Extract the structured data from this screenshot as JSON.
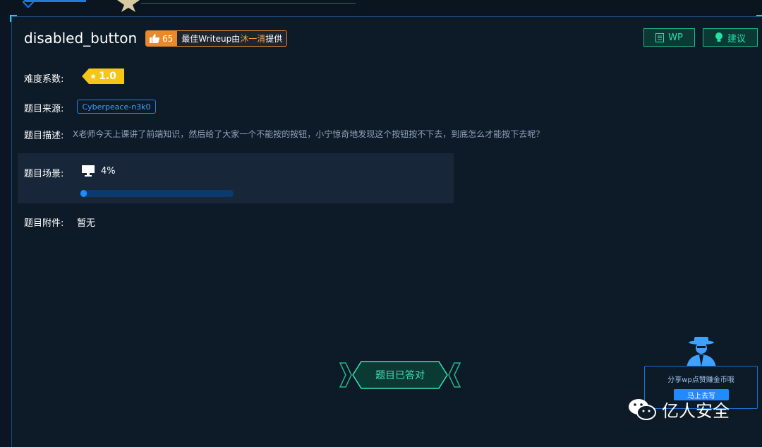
{
  "challenge": {
    "title": "disabled_button",
    "likes": "65",
    "writeup_prefix": "最佳Writeup由",
    "writeup_author": "沐一清",
    "writeup_suffix": "提供"
  },
  "actions": {
    "wp_label": "WP",
    "suggest_label": "建议"
  },
  "details": {
    "difficulty_label": "难度系数:",
    "difficulty_value": "1.0",
    "source_label": "题目来源:",
    "source_value": "Cyberpeace-n3k0",
    "description_label": "题目描述:",
    "description_value": "X老师今天上课讲了前端知识，然后给了大家一个不能按的按钮，小宁惊奇地发现这个按钮按不下去，到底怎么才能按下去呢？",
    "scene_label": "题目场景:",
    "scene_percent": "4%",
    "scene_progress": 0.04,
    "attachment_label": "题目附件:",
    "attachment_value": "暂无"
  },
  "status": {
    "answered_label": "题目已答对"
  },
  "share": {
    "text": "分享wp点赞赚金币哦",
    "button_label": "马上去写"
  },
  "watermark": {
    "text": "亿人安全"
  },
  "colors": {
    "accent": "#1f8bff",
    "teal": "#26e0a6",
    "orange": "#e88a2c",
    "gold": "#f5c518"
  },
  "icons": [
    "thumbs-up-icon",
    "document-icon",
    "lightbulb-icon",
    "star-icon",
    "monitor-icon",
    "spy-icon",
    "wechat-icon"
  ]
}
